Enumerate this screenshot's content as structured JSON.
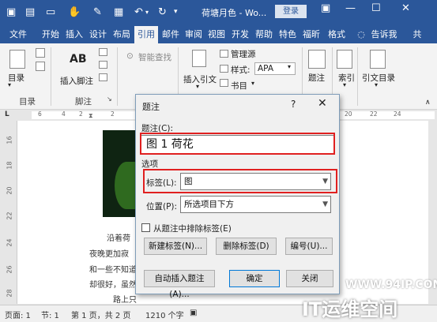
{
  "titlebar": {
    "doc_title": "荷塘月色 - Wo...",
    "login": "登录"
  },
  "tabs": [
    "文件",
    "开始",
    "插入",
    "设计",
    "布局",
    "引用",
    "邮件",
    "审阅",
    "视图",
    "开发",
    "帮助",
    "特色",
    "福昕",
    "格式",
    "告诉我",
    "共"
  ],
  "ribbon": {
    "toc": "目录",
    "insert_footnote": "插入脚注",
    "ab": "AB",
    "smart_lookup": "智能查找",
    "insert_citation": "插入引文",
    "manage_sources": "管理源",
    "style_label": "样式:",
    "style_value": "APA",
    "bibliography": "书目",
    "caption": "题注",
    "index": "索引",
    "citation_toc": "引文目录",
    "group_toc": "目录",
    "group_footnote": "脚注"
  },
  "ruler": {
    "h_left": "L",
    "h_numbers": [
      "6",
      "4",
      "2",
      "2",
      "4",
      "6",
      "8",
      "10",
      "12",
      "14",
      "16",
      "18",
      "20",
      "22",
      "24"
    ],
    "v_numbers": [
      "16",
      "18",
      "20",
      "22",
      "24",
      "26",
      "28"
    ]
  },
  "document": {
    "lines": [
      "沿着荷",
      "夜晚更加寂",
      "和一些不知道",
      "却很好，虽然",
      "路上只"
    ]
  },
  "dialog": {
    "title": "题注",
    "help": "?",
    "close": "✕",
    "caption_label": "题注(C):",
    "caption_value": "图 1 荷花",
    "options_label": "选项",
    "label_label": "标签(L):",
    "label_value": "图",
    "position_label": "位置(P):",
    "position_value": "所选项目下方",
    "exclude_label": "从题注中排除标签(E)",
    "btn_new_label": "新建标签(N)...",
    "btn_delete_label": "删除标签(D)",
    "btn_numbering": "编号(U)...",
    "btn_autocaption": "自动插入题注(A)...",
    "btn_ok": "确定",
    "btn_close": "关闭"
  },
  "statusbar": {
    "page": "页面: 1",
    "section": "节: 1",
    "page_of": "第 1 页，共 2 页",
    "words": "1210 个字"
  },
  "watermark": {
    "site": "WWW.94IP.COM",
    "brand": "IT运维空间"
  },
  "colors": {
    "accent": "#2b579a",
    "highlight": "#e02020"
  }
}
